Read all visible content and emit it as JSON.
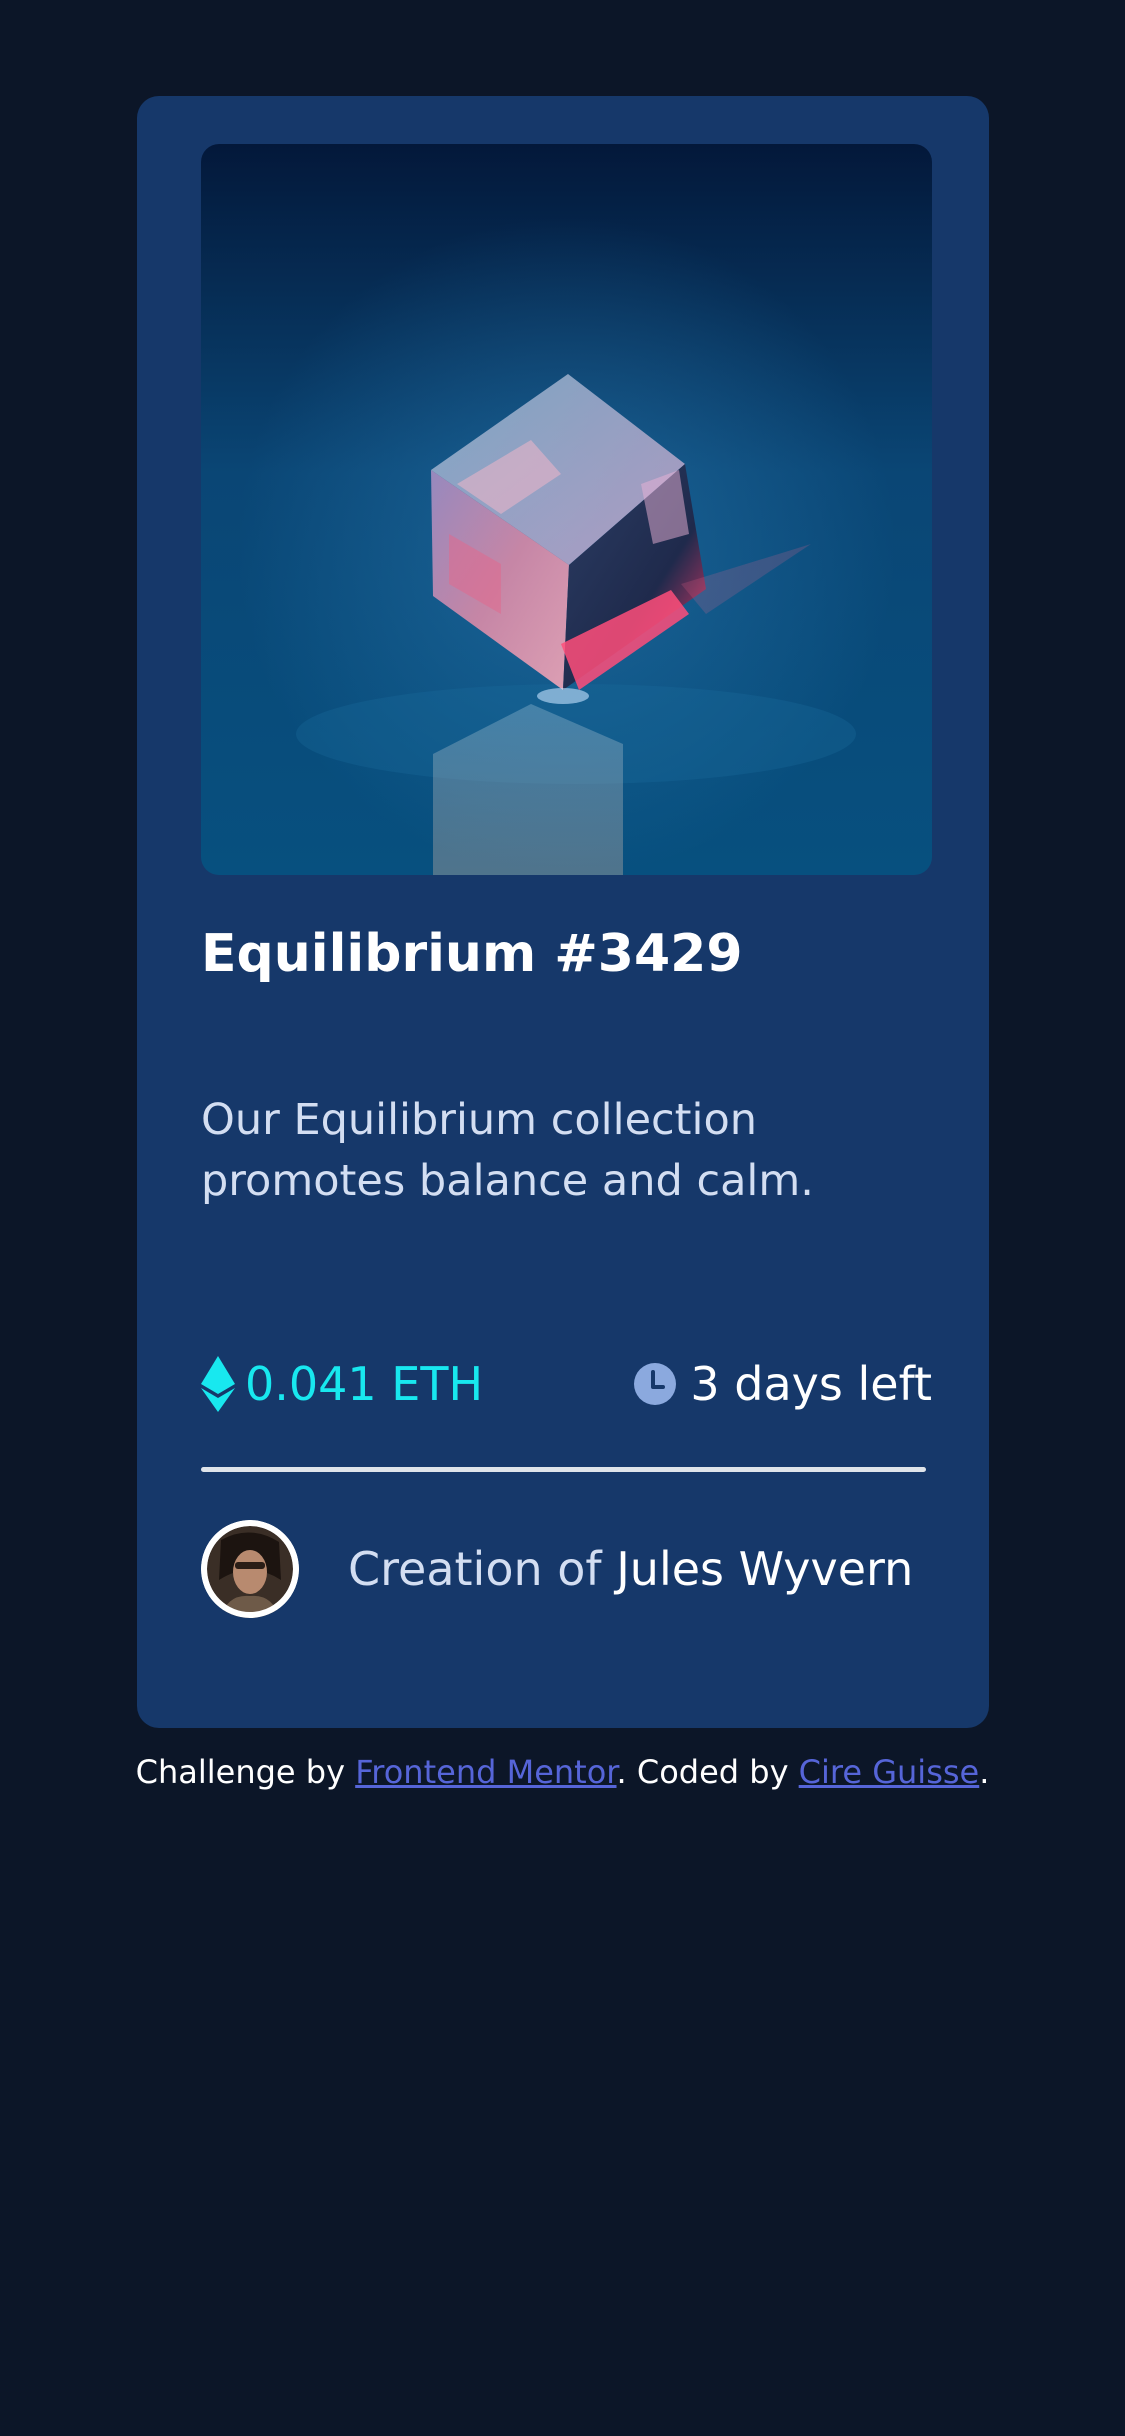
{
  "card": {
    "image_alt": "Equilibrium",
    "title": "Equilibrium #3429",
    "description": "Our Equilibrium collection promotes balance and calm.",
    "price": "0.041 ETH",
    "time_left": "3 days left",
    "creator_prefix": "Creation of ",
    "creator_name": "Jules Wyvern"
  },
  "icons": {
    "price": "ethereum-icon",
    "time": "clock-icon",
    "creator": "avatar-image"
  },
  "attribution": {
    "prefix": "Challenge by ",
    "link1": "Frontend Mentor",
    "middle": ". Coded by ",
    "link2": "Cire Guisse",
    "suffix": "."
  },
  "colors": {
    "page_background": "#0c1628",
    "card_background": "#16386a",
    "accent_cyan": "#18e8ef",
    "text_muted": "#d3def2",
    "link": "#5665d8"
  }
}
